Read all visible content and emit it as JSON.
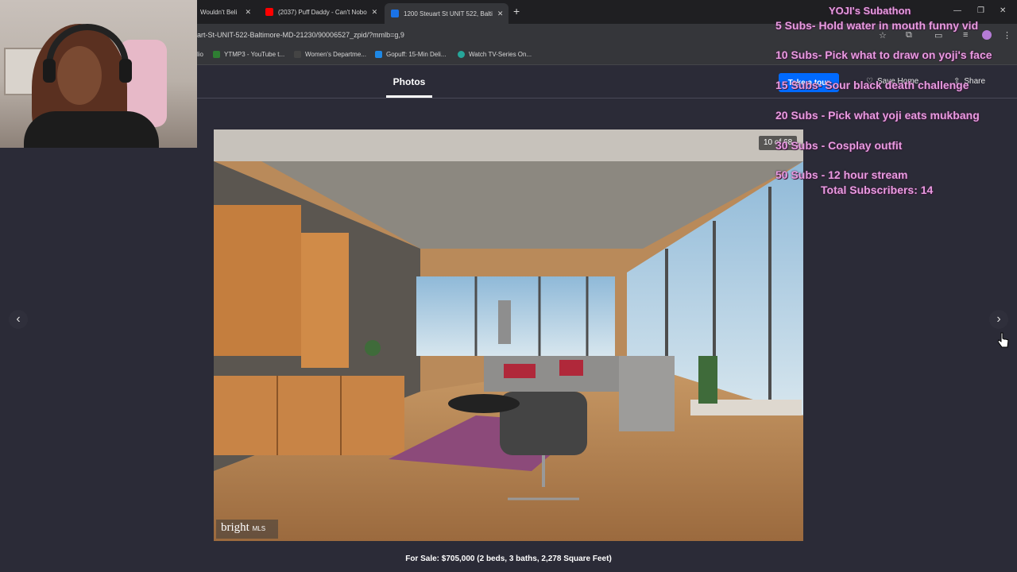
{
  "browser": {
    "tabs": [
      {
        "title": "Wouldn't Beli"
      },
      {
        "title": "(2037) Puff Daddy - Can't Nobo"
      },
      {
        "title": "1200 Steuart St UNIT 522, Balti"
      }
    ],
    "url": "art-St-UNIT-522-Baltimore-MD-21230/90006527_zpid/?mmlb=g,9",
    "bookmarks": [
      "lio",
      "YTMP3 - YouTube t...",
      "Women's Departme...",
      "Gopuff: 15-Min Deli...",
      "Watch TV-Series On..."
    ],
    "profile_label": "Pick a Profile"
  },
  "page": {
    "photos_tab": "Photos",
    "take_tour": "Take a tour",
    "save_home": "Save Home",
    "share": "Share",
    "photo_counter": "10 of 68",
    "brand_main": "bright",
    "brand_sub": "MLS",
    "caption": "For Sale: $705,000 (2 beds, 3 baths, 2,278 Square Feet)"
  },
  "overlay": {
    "title": "YOJI's Subathon",
    "goals": [
      "5 Subs- Hold water in mouth funny vid",
      "10 Subs- Pick what to draw on yoji's face",
      "15 Subs- Sour black death challenge",
      "20 Subs - Pick what yoji eats mukbang",
      "30 Subs - Cosplay outfit",
      "50 Subs - 12 hour stream"
    ],
    "total": "Total Subscribers: 14"
  },
  "colors": {
    "overlay_pink": "#e89be0",
    "tour_blue": "#006aff",
    "page_bg": "#2b2b37"
  },
  "icons": [
    "star-icon",
    "extensions-icon",
    "cast-icon",
    "menu-icon",
    "heart-icon",
    "share-icon",
    "chevron-left-icon",
    "chevron-right-icon"
  ]
}
